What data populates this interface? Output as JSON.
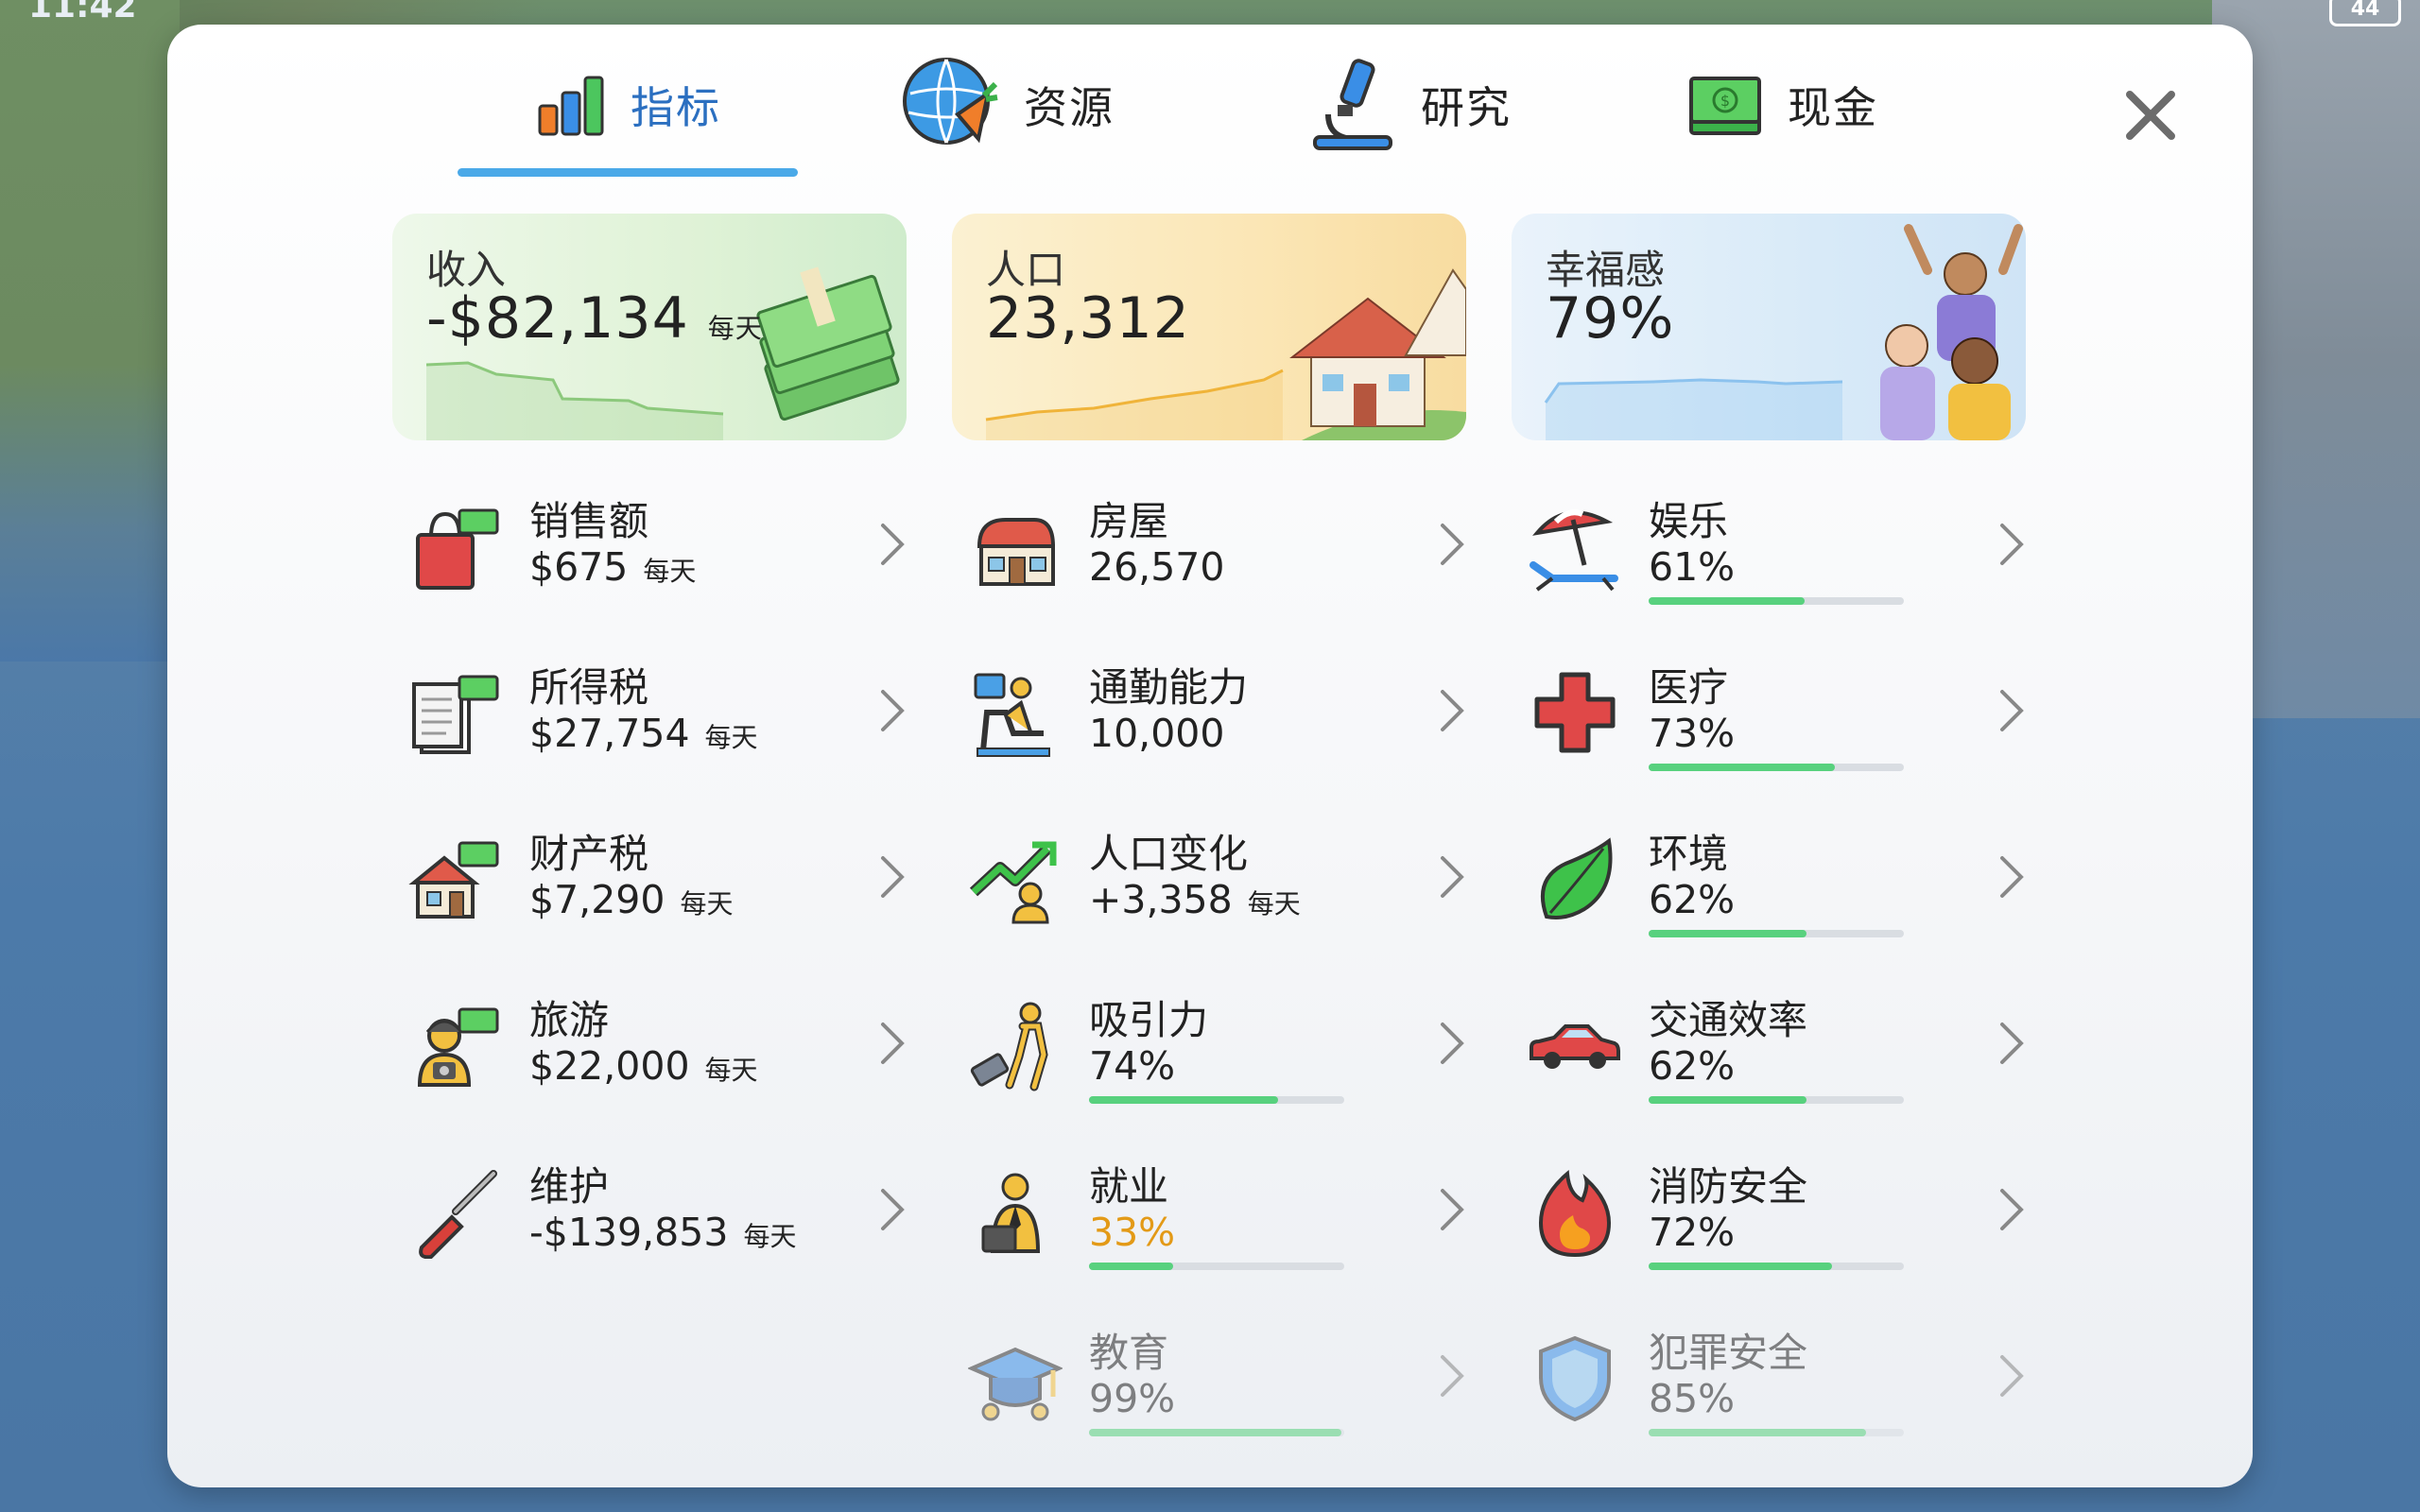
{
  "status_bar": {
    "time": "11:42",
    "battery": "44"
  },
  "tabs": [
    {
      "label": "指标",
      "icon": "bar-chart-icon",
      "active": true
    },
    {
      "label": "资源",
      "icon": "globe-carrot-icon",
      "active": false
    },
    {
      "label": "研究",
      "icon": "microscope-icon",
      "active": false
    },
    {
      "label": "现金",
      "icon": "cash-icon",
      "active": false
    }
  ],
  "cards": {
    "income": {
      "title": "收入",
      "value": "-$82,134",
      "unit": "每天"
    },
    "population": {
      "title": "人口",
      "value": "23,312"
    },
    "happiness": {
      "title": "幸福感",
      "value": "79%"
    }
  },
  "income_items": [
    {
      "label": "销售额",
      "value": "$675",
      "unit": "每天",
      "icon": "shopping-bag-icon"
    },
    {
      "label": "所得税",
      "value": "$27,754",
      "unit": "每天",
      "icon": "tax-document-icon"
    },
    {
      "label": "财产税",
      "value": "$7,290",
      "unit": "每天",
      "icon": "house-cash-icon"
    },
    {
      "label": "旅游",
      "value": "$22,000",
      "unit": "每天",
      "icon": "tourist-icon"
    },
    {
      "label": "维护",
      "value": "-$139,853",
      "unit": "每天",
      "icon": "screwdriver-icon"
    }
  ],
  "population_items": [
    {
      "label": "房屋",
      "value": "26,570",
      "icon": "house-icon"
    },
    {
      "label": "通勤能力",
      "value": "10,000",
      "icon": "commuter-seat-icon"
    },
    {
      "label": "人口变化",
      "value": "+3,358",
      "unit": "每天",
      "icon": "growth-arrow-icon"
    },
    {
      "label": "吸引力",
      "value": "74%",
      "progress": 0.74,
      "icon": "traveler-icon"
    },
    {
      "label": "就业",
      "value": "33%",
      "progress": 0.33,
      "icon": "worker-icon"
    },
    {
      "label": "教育",
      "value": "99%",
      "progress": 0.99,
      "icon": "graduation-cap-icon"
    }
  ],
  "happiness_items": [
    {
      "label": "娱乐",
      "value": "61%",
      "progress": 0.61,
      "icon": "beach-umbrella-icon"
    },
    {
      "label": "医疗",
      "value": "73%",
      "progress": 0.73,
      "icon": "medical-cross-icon"
    },
    {
      "label": "环境",
      "value": "62%",
      "progress": 0.62,
      "icon": "leaf-icon"
    },
    {
      "label": "交通效率",
      "value": "62%",
      "progress": 0.62,
      "icon": "car-icon"
    },
    {
      "label": "消防安全",
      "value": "72%",
      "progress": 0.72,
      "icon": "fire-icon"
    },
    {
      "label": "犯罪安全",
      "value": "85%",
      "progress": 0.85,
      "icon": "shield-icon"
    }
  ],
  "colors": {
    "accent": "#2b6fc0",
    "tab_underline": "#4aa9e8",
    "progress": "#58d17e",
    "warning": "#e39a17"
  }
}
